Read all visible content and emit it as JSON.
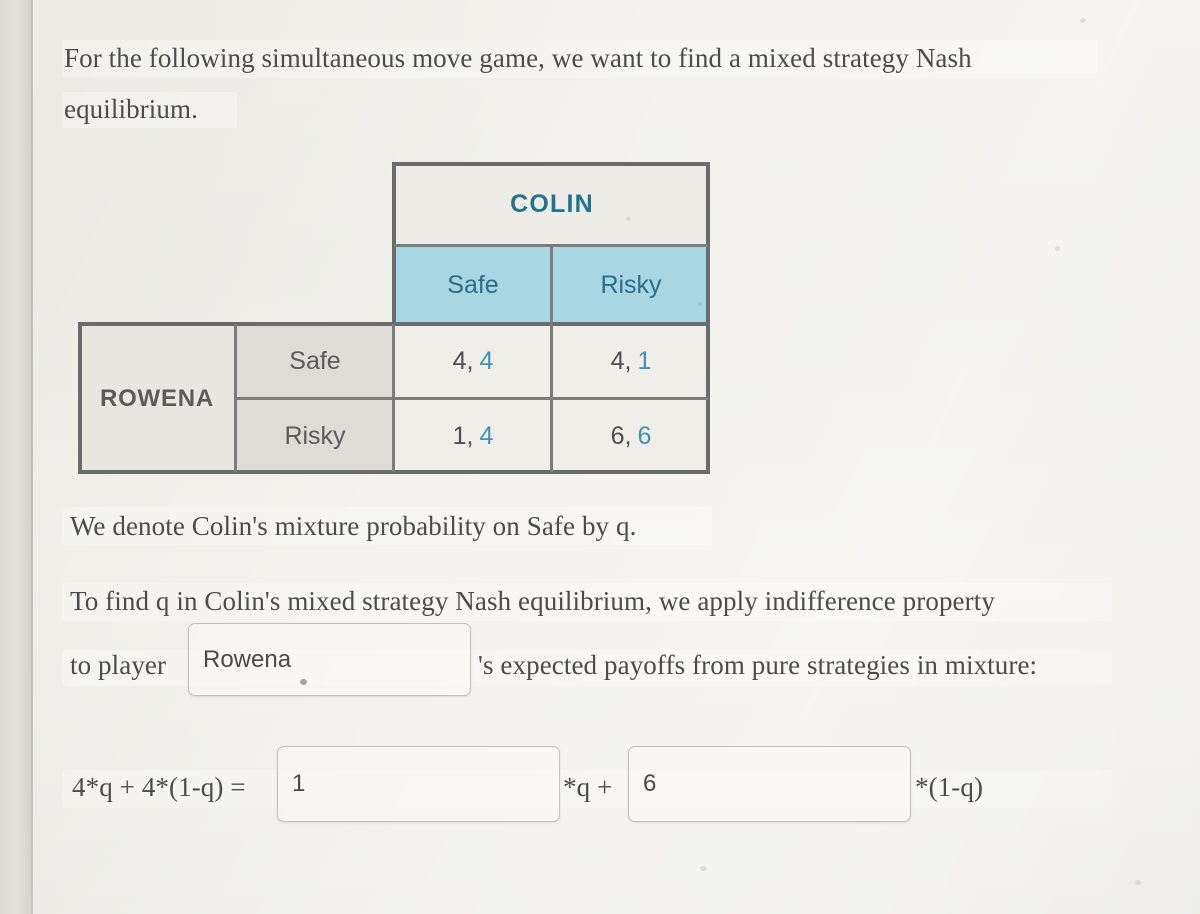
{
  "document": {
    "intro_line1": "For the following simultaneous move game, we want to find a mixed strategy Nash",
    "intro_line2": "equilibrium.",
    "denote_line": "We denote Colin's mixture probability on Safe by q.",
    "tofind_line": "To find q in Colin's mixed strategy Nash equilibrium, we apply indifference property",
    "to_player_label": "to player",
    "expected_payoffs_suffix": "'s expected payoffs from pure strategies in mixture:"
  },
  "matrix": {
    "column_player_label": "COLIN",
    "row_player_label": "ROWENA",
    "column_strategies": [
      "Safe",
      "Risky"
    ],
    "row_strategies": [
      "Safe",
      "Risky"
    ],
    "cells": [
      [
        {
          "row_payoff": "4",
          "separator": ",",
          "col_payoff": "4"
        },
        {
          "row_payoff": "4",
          "separator": ",",
          "col_payoff": "1"
        }
      ],
      [
        {
          "row_payoff": "1",
          "separator": ",",
          "col_payoff": "4"
        },
        {
          "row_payoff": "6",
          "separator": ",",
          "col_payoff": "6"
        }
      ]
    ],
    "colors": {
      "column_header_accent": "#1f7490",
      "column_strategy_bg": "#a9d6e3",
      "row_header_bg": "#e8e7e1",
      "row_strategy_bg": "#dddcd6",
      "payoff_bg": "#efeee8",
      "col_payoff_accent": "#3d93b5",
      "border": "#6a6b6c"
    }
  },
  "form": {
    "player_select": {
      "value": "Rowena",
      "placeholder": "Choose a player"
    },
    "equation": {
      "lhs": "4*q + 4*(1-q) =",
      "input_safe": {
        "value": "1",
        "placeholder": ""
      },
      "mid": "*q +",
      "input_risky": {
        "value": "6",
        "placeholder": ""
      },
      "tail": "*(1-q)"
    }
  }
}
